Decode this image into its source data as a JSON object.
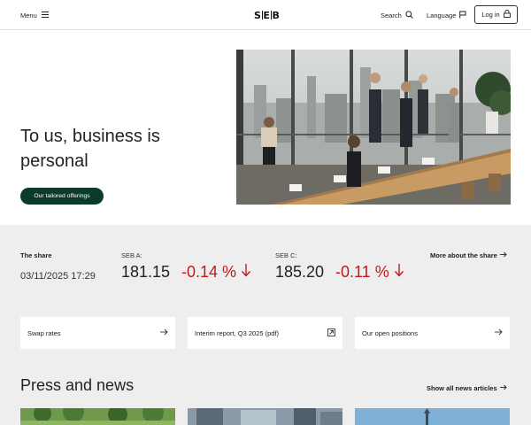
{
  "header": {
    "menu_label": "Menu",
    "logo_left": "S",
    "logo_right": "B",
    "search_label": "Search",
    "language_label": "Language",
    "login_label": "Log in"
  },
  "hero": {
    "title": "To us, business is personal",
    "cta_label": "Our tailored offerings"
  },
  "share": {
    "label": "The share",
    "datetime": "03/11/2025 17:29",
    "seb_a": {
      "label": "SEB A:",
      "price": "181.15",
      "change": "-0.14 %"
    },
    "seb_c": {
      "label": "SEB C:",
      "price": "185.20",
      "change": "-0.11 %"
    },
    "more_link": "More about the share"
  },
  "cards": [
    {
      "label": "Swap rates"
    },
    {
      "label": "Interim report, Q3 2025 (pdf)"
    },
    {
      "label": "Our open positions"
    }
  ],
  "press": {
    "title": "Press and news",
    "all_link": "Show all news articles"
  },
  "colors": {
    "accent_green": "#0c3b2a",
    "negative_red": "#c01a1a",
    "section_grey": "#eeeeee"
  }
}
